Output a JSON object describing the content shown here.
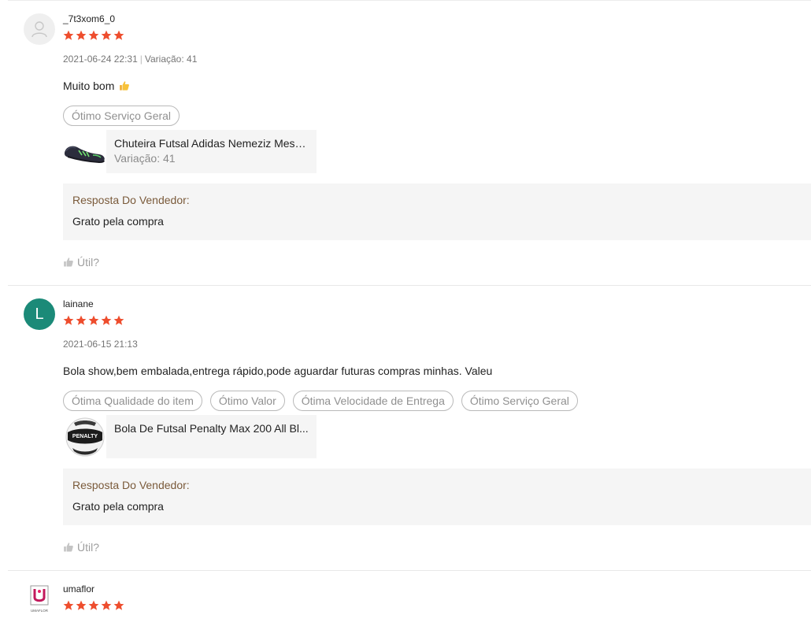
{
  "colors": {
    "star": "#ee4d2d",
    "avatar_letter_bg": "#1b8a78",
    "reply_title": "#7a5a3a",
    "tag_border": "#b9b9b9"
  },
  "reviews": [
    {
      "username": "_7t3xom6_0",
      "avatar": "user-placeholder-icon",
      "rating": 5,
      "date": "2021-06-24 22:31",
      "separator": "|",
      "variation_meta": "Variação: 41",
      "comment": "Muito bom",
      "comment_emoji": "thumbs-up-emoji",
      "tags": [
        "Ótimo Serviço Geral"
      ],
      "product": {
        "name": "Chuteira Futsal Adidas Nemeziz Mess...",
        "variation": "Variação: 41",
        "image": "soccer-shoe-image"
      },
      "seller_reply_title": "Resposta Do Vendedor:",
      "seller_reply_text": "Grato pela compra",
      "helpful_label": "Útil?"
    },
    {
      "username": "lainane",
      "avatar_letter": "L",
      "rating": 5,
      "date": "2021-06-15 21:13",
      "comment": "Bola show,bem embalada,entrega rápido,pode aguardar futuras compras minhas. Valeu",
      "tags": [
        "Ótima Qualidade do item",
        "Ótimo Valor",
        "Ótima Velocidade de Entrega",
        "Ótimo Serviço Geral"
      ],
      "product": {
        "name": "Bola De Futsal Penalty Max 200 All Bl...",
        "image": "futsal-ball-image",
        "image_text": "PENALTY"
      },
      "seller_reply_title": "Resposta Do Vendedor:",
      "seller_reply_text": "Grato pela compra",
      "helpful_label": "Útil?"
    },
    {
      "username": "umaflor",
      "avatar": "umaflor-logo",
      "avatar_logo_text": "UMAFLOR",
      "rating": 5
    }
  ]
}
